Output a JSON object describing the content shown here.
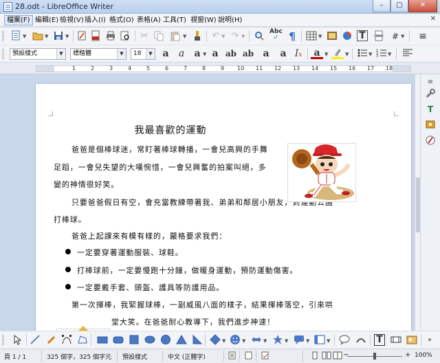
{
  "window": {
    "title": "28.odt - LibreOffice Writer",
    "minimize": "–",
    "maximize": "□",
    "close": "✕"
  },
  "menu": [
    {
      "label": "檔案(F)",
      "active": true
    },
    {
      "label": "編輯(E)"
    },
    {
      "label": "檢視(V)"
    },
    {
      "label": "插入(I)"
    },
    {
      "label": "格式(O)"
    },
    {
      "label": "表格(A)"
    },
    {
      "label": "工具(T)"
    },
    {
      "label": "視窗(W)"
    },
    {
      "label": "說明(H)"
    }
  ],
  "menu_close": "✕",
  "formatting": {
    "style": "預設樣式",
    "font": "標楷體",
    "size": "18"
  },
  "ruler": {
    "numbers": [
      "1",
      "2",
      "3",
      "4",
      "5",
      "6",
      "7",
      "8",
      "9",
      "10",
      "11",
      "12",
      "13",
      "14",
      "15",
      "16",
      "17",
      "18"
    ]
  },
  "document": {
    "title": "我最喜歡的運動",
    "lines": [
      {
        "text": "爸爸是個棒球迷，常盯著棒球轉播，一會兒高興的手舞"
      },
      {
        "text": "足蹈，一會兒失望的大嘆惋惜，一會兒興奮的拍案叫絕，多"
      },
      {
        "text": "變的神情很好笑。"
      },
      {
        "text": "只要爸爸假日有空，會充當教練帶著我、弟弟和鄰居小朋友，到運動公園"
      },
      {
        "text": "打棒球。"
      },
      {
        "text": "爸爸上起課來有模有樣的，嚴格要求我們："
      },
      {
        "text": "一定要穿著運動服裝、球鞋。"
      },
      {
        "text": "打棒球前，一定要慢跑十分鐘，做暖身運動，預防運動傷害。"
      },
      {
        "text": "一定要戴手套、頭盔、護具等防護用品。"
      },
      {
        "text": "第一次揮棒，我緊握球棒，一副威風八面的樣子，結果揮棒落空，引來哄"
      },
      {
        "text": "堂大笑。在爸爸耐心教導下，我們進步神速！"
      }
    ]
  },
  "status": {
    "page": "頁 1 / 1",
    "words": "325 個字，325 個字元",
    "page_style": "預設樣式",
    "language": "中文 (正體字)",
    "zoom": "100%"
  }
}
